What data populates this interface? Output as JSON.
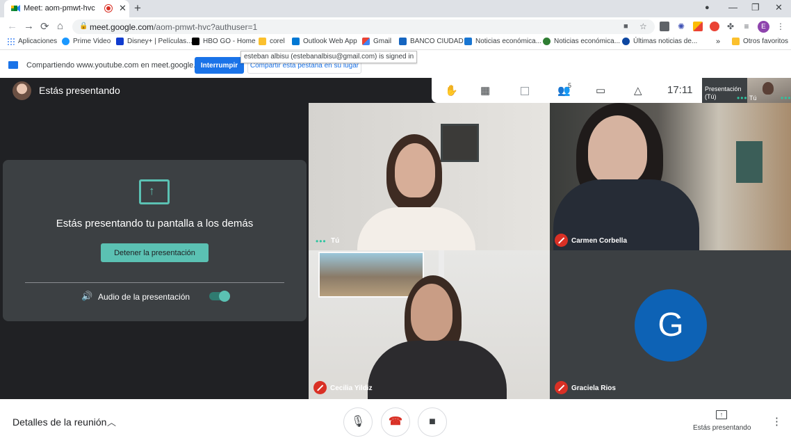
{
  "browser": {
    "tab_title": "Meet: aom-pmwt-hvc",
    "tab_close": "✕",
    "new_tab": "+",
    "window_controls": {
      "caret": "●",
      "minimize": "—",
      "restore": "❐",
      "close": "✕"
    },
    "nav": {
      "back": "←",
      "forward": "→",
      "reload": "⟳",
      "home": "⌂"
    },
    "url_host": "meet.google.com",
    "url_path": "/aom-pmwt-hvc?authuser=1",
    "profile_letter": "E",
    "bookmarks": [
      {
        "label": "Aplicaciones",
        "color": "#4285f4"
      },
      {
        "label": "Prime Video",
        "color": "#1a98ff"
      },
      {
        "label": "Disney+ | Películas...",
        "color": "#113ccf"
      },
      {
        "label": "HBO GO - Home",
        "color": "#000000"
      },
      {
        "label": "corel",
        "color": "#fbc02d"
      },
      {
        "label": "Outlook Web App",
        "color": "#0078d4"
      },
      {
        "label": "Gmail",
        "color": "#ea4335"
      },
      {
        "label": "BANCO CIUDAD",
        "color": "#1565c0"
      },
      {
        "label": "Noticias económica...",
        "color": "#1976d2"
      },
      {
        "label": "Noticias económica...",
        "color": "#2e7d32"
      },
      {
        "label": "Últimas noticias de...",
        "color": "#0d47a1"
      }
    ],
    "bookmarks_overflow": "»",
    "other_bookmarks": "Otros favoritos"
  },
  "infobar": {
    "message": "Compartiendo www.youtube.com en meet.google.com",
    "stop_label": "Interrumpir",
    "share_tab_label": "Compartir esta pestaña en su lugar",
    "tooltip": "esteban albisu (estebanalbisu@gmail.com) is signed in"
  },
  "meet": {
    "presenting_header": "Estás presentando",
    "clock": "17:11",
    "participants_count": "5",
    "presentation_thumb_label": "Presentación (Tú)",
    "you_thumb_label": "Tú",
    "card": {
      "title": "Estás presentando tu pantalla a los demás",
      "stop_button": "Detener la presentación",
      "audio_label": "Audio de la presentación",
      "audio_on": true
    },
    "tiles": [
      {
        "name": "Tú",
        "muted": false
      },
      {
        "name": "Carmen Corbella",
        "muted": true
      },
      {
        "name": "Cecilia Yildiz",
        "muted": true
      },
      {
        "name": "Graciela Rios",
        "muted": true,
        "avatar_letter": "G"
      }
    ],
    "colors": {
      "accent": "#5bc1b3",
      "mute_red": "#d93025",
      "avatar_blue": "#0d62b5"
    }
  },
  "bottom": {
    "details_label": "Detalles de la reunión",
    "presenting_label": "Estás presentando"
  }
}
